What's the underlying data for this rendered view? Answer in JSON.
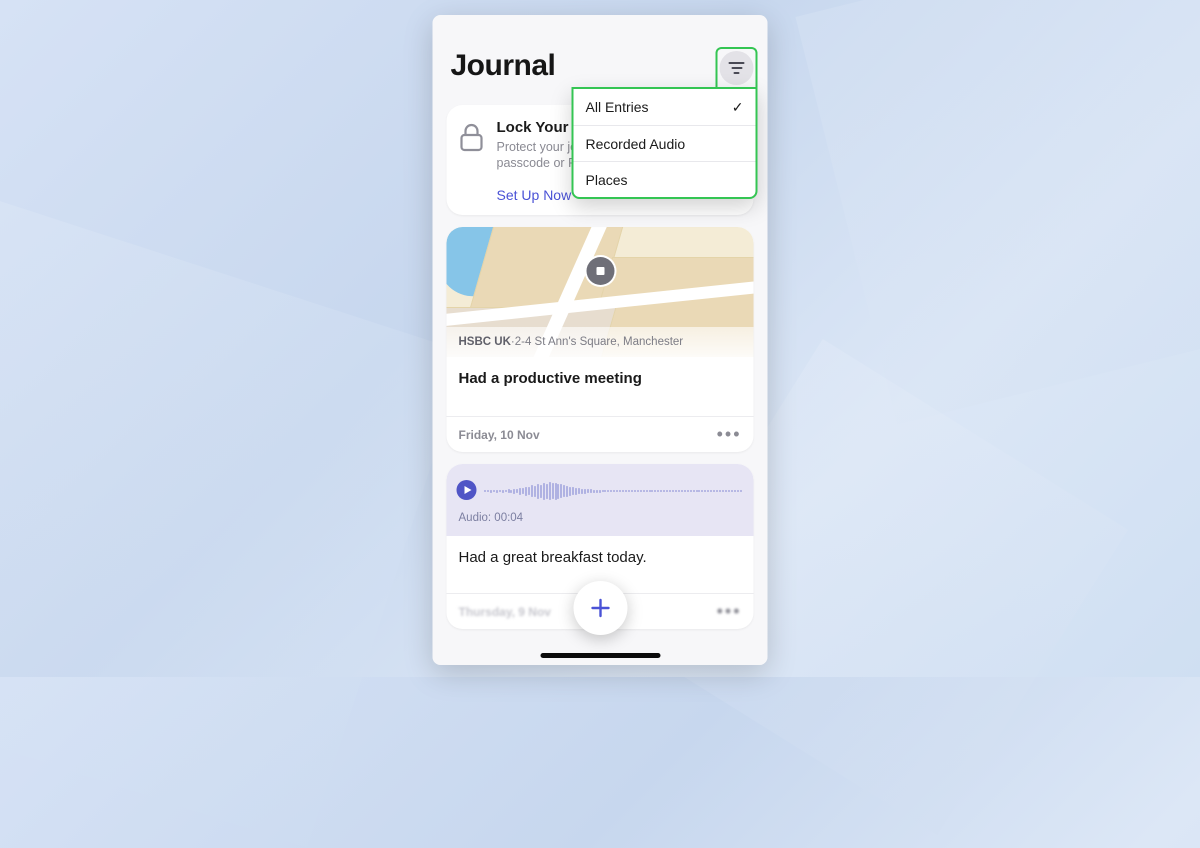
{
  "header": {
    "title": "Journal"
  },
  "filter": {
    "items": [
      {
        "label": "All Entries",
        "selected": true
      },
      {
        "label": "Recorded Audio",
        "selected": false
      },
      {
        "label": "Places",
        "selected": false
      }
    ]
  },
  "lock_card": {
    "title": "Lock Your Journal",
    "subtitle_line1": "Protect your journal with a",
    "subtitle_line2": "passcode or Face ID.",
    "cta": "Set Up Now"
  },
  "entries": [
    {
      "place_name": "HSBC UK",
      "place_address": "2-4 St Ann's Square, Manchester",
      "title": "Had a productive meeting",
      "date": "Friday, 10 Nov"
    },
    {
      "audio_label": "Audio: 00:04",
      "title": "Had a great breakfast today.",
      "date": "Thursday, 9 Nov"
    }
  ],
  "glyphs": {
    "more": "•••",
    "check": "✓",
    "dot": " · "
  }
}
